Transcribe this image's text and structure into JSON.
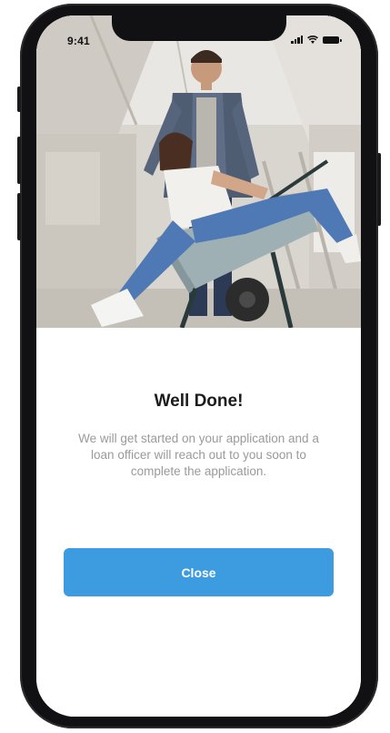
{
  "status_bar": {
    "time": "9:41",
    "icons": [
      "cellular-signal-icon",
      "wifi-icon",
      "battery-icon"
    ]
  },
  "hero_image": {
    "description_icon": "couple-wheelbarrow-photo"
  },
  "dialog": {
    "title": "Well Done!",
    "message": "We will get started on your application and a loan officer will reach out to you soon to complete the application.",
    "close_label": "Close"
  },
  "colors": {
    "primary_button": "#3d9be0",
    "title_text": "#1c1c1c",
    "message_text": "#9a9a9a",
    "phone_frame": "#111113"
  }
}
